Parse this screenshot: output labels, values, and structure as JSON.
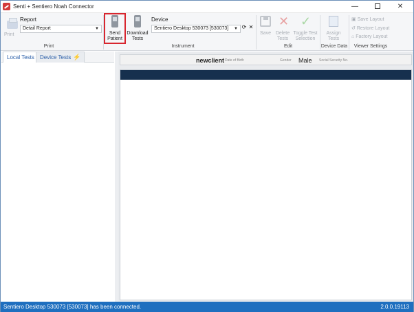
{
  "window": {
    "title": "Senti + Sentiero Noah Connector",
    "icons": {
      "logo": "app-logo-icon",
      "minimize": "minimize-icon",
      "maximize": "maximize-icon",
      "close": "close-icon"
    }
  },
  "ribbon": {
    "print_group": {
      "label": "Print",
      "print_button": "Print",
      "report_label": "Report",
      "report_value": "Detail Report"
    },
    "instrument_group": {
      "label": "Instrument",
      "send_patient": [
        "Send",
        "Patient"
      ],
      "download_tests": [
        "Download",
        "Tests"
      ],
      "device_label": "Device",
      "device_value": "Sentiero Desktop 530073 [530073]"
    },
    "edit_group": {
      "label": "Edit",
      "save": "Save",
      "delete_tests": [
        "Delete",
        "Tests"
      ],
      "toggle_test_selection": [
        "Toggle Test",
        "Selection"
      ]
    },
    "device_data_group": {
      "label": "Device Data",
      "assign_tests": [
        "Assign",
        "Tests"
      ]
    },
    "viewer_settings_group": {
      "label": "Viewer Settings",
      "save_layout": "Save Layout",
      "restore_layout": "Restore Layout",
      "factory_layout": "Factory Layout"
    }
  },
  "left_panel": {
    "tabs": [
      "Local Tests",
      "Device Tests"
    ]
  },
  "patient": {
    "name": "newclient",
    "dob_label": "Date of Birth",
    "gender_label": "Gender",
    "gender_value": "Male",
    "ssn_label": "Social Security No."
  },
  "status": {
    "message": "Sentiero Desktop 530073 [530073] has been connected.",
    "version": "2.0.0.19113"
  },
  "colors": {
    "status_bar": "#1f6fbf",
    "header_bar": "#16304e",
    "highlight": "#d8262f"
  }
}
